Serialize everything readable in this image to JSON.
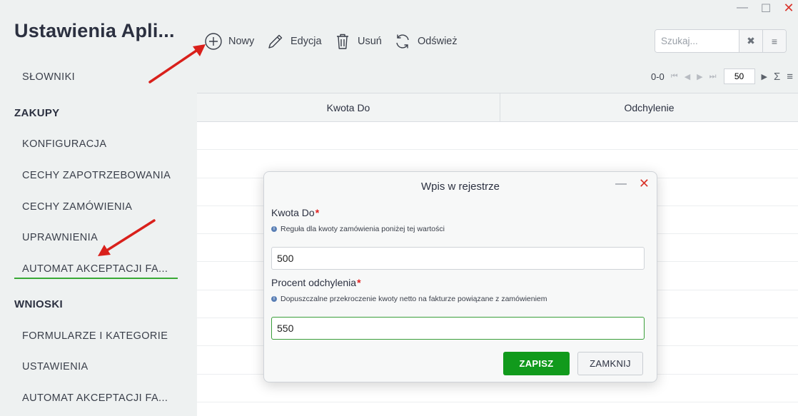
{
  "window": {
    "minimize_icon": "—",
    "maximize_icon": "☐",
    "close_icon": "✕"
  },
  "app": {
    "title": "Ustawienia Apli..."
  },
  "sidebar": {
    "top_item": "SŁOWNIKI",
    "sections": [
      {
        "title": "ZAKUPY",
        "items": [
          "KONFIGURACJA",
          "CECHY ZAPOTRZEBOWANIA",
          "CECHY ZAMÓWIENIA",
          "UPRAWNIENIA",
          "AUTOMAT AKCEPTACJI FA..."
        ]
      },
      {
        "title": "WNIOSKI",
        "items": [
          "FORMULARZE I KATEGORIE",
          "USTAWIENIA",
          "AUTOMAT AKCEPTACJI FA..."
        ]
      }
    ],
    "active_item": "AUTOMAT AKCEPTACJI FA..."
  },
  "toolbar": {
    "new": "Nowy",
    "edit": "Edycja",
    "delete": "Usuń",
    "refresh": "Odśwież"
  },
  "search": {
    "placeholder": "Szukaj...",
    "clear_icon": "✖",
    "menu_icon": "≡"
  },
  "pager": {
    "range": "0-0",
    "page_size": "50",
    "sum_icon": "Σ",
    "menu_icon": "≡"
  },
  "grid": {
    "columns": [
      "Kwota Do",
      "Odchylenie"
    ],
    "rows": []
  },
  "dialog": {
    "title": "Wpis w rejestrze",
    "minimize_icon": "—",
    "close_icon": "✕",
    "fields": [
      {
        "label": "Kwota Do",
        "hint": "Reguła dla kwoty zamówienia poniżej tej wartości",
        "value": "500"
      },
      {
        "label": "Procent odchylenia",
        "hint": "Dopuszczalne przekroczenie kwoty netto na fakturze powiązane z zamówieniem",
        "value": "550"
      }
    ],
    "required_mark": "*",
    "save": "ZAPISZ",
    "close": "ZAMKNIJ"
  },
  "colors": {
    "accent_green": "#119a1c",
    "underline_green": "#39a935",
    "arrow_red": "#d9201b",
    "close_red": "#d9342b"
  }
}
